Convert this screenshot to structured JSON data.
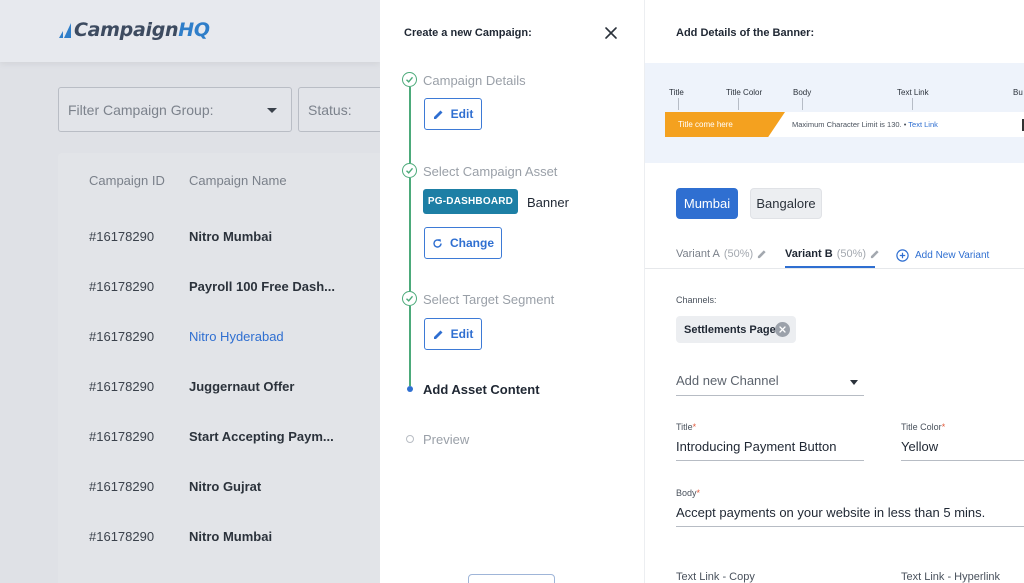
{
  "app": {
    "logo": {
      "main": "Campaign",
      "accent": "HQ"
    },
    "filters": {
      "group_placeholder": "Filter Campaign Group:",
      "status_placeholder": "Status:"
    },
    "table": {
      "headers": [
        "Campaign ID",
        "Campaign Name"
      ],
      "rows": [
        {
          "id": "#16178290",
          "name": "Nitro Mumbai"
        },
        {
          "id": "#16178290",
          "name": "Payroll 100 Free Dash..."
        },
        {
          "id": "#16178290",
          "name": "Nitro Hyderabad"
        },
        {
          "id": "#16178290",
          "name": "Juggernaut Offer"
        },
        {
          "id": "#16178290",
          "name": "Start Accepting Paym..."
        },
        {
          "id": "#16178290",
          "name": "Nitro Gujrat"
        },
        {
          "id": "#16178290",
          "name": "Nitro Mumbai"
        }
      ]
    }
  },
  "stepper": {
    "title": "Create a new Campaign:",
    "steps": [
      {
        "label": "Campaign Details",
        "action": "Edit"
      },
      {
        "label": "Select Campaign Asset",
        "asset_tag": "PG-DASHBOARD",
        "asset_name": "Banner",
        "action": "Change"
      },
      {
        "label": "Select Target Segment",
        "action": "Edit"
      },
      {
        "label": "Add Asset Content"
      },
      {
        "label": "Preview"
      }
    ]
  },
  "details": {
    "title": "Add Details of the Banner:",
    "preview": {
      "labels": [
        "Title",
        "Title Color",
        "Body",
        "Text Link",
        "Bu"
      ],
      "banner_title": "Title come here",
      "banner_body": "Maximum Character Limit is 130.",
      "banner_link": "Text Link"
    },
    "cities": [
      "Mumbai",
      "Bangalore"
    ],
    "variants": [
      {
        "name": "Variant A",
        "pct": "(50%)"
      },
      {
        "name": "Variant B",
        "pct": "(50%)"
      }
    ],
    "add_variant": "Add New Variant",
    "channels_label": "Channels:",
    "channel_chip": "Settlements Page",
    "add_channel_placeholder": "Add new Channel",
    "title_label": "Title",
    "title_value": "Introducing Payment Button",
    "title_color_label": "Title Color",
    "title_color_value": "Yellow",
    "body_label": "Body",
    "body_value": "Accept payments on your website in less than 5 mins.",
    "text_link_copy_label": "Text Link - Copy",
    "text_link_hyperlink_label": "Text Link - Hyperlink"
  },
  "colors": {
    "accent": "#2f6fd1",
    "success": "#4caa7a",
    "banner": "#f4a11f",
    "asset_tag": "#1d7fa5"
  }
}
